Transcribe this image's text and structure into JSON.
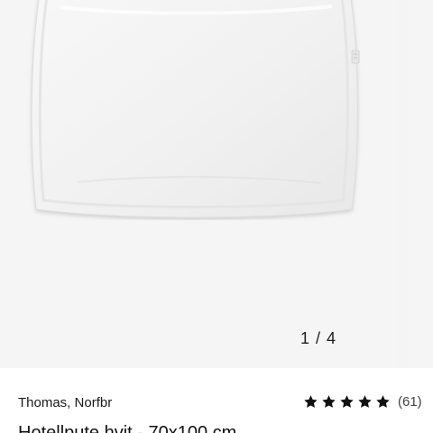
{
  "gallery": {
    "image_icon": "pillow-product-image",
    "counter": "1 / 4"
  },
  "product": {
    "brand": "Thomas, Norfbr",
    "rating_stars": 5,
    "review_count": "(61)",
    "title": "Hotellpute hvit - 70x100 cm"
  },
  "colors": {
    "star": "#111111",
    "background": "#f5f5f5"
  }
}
